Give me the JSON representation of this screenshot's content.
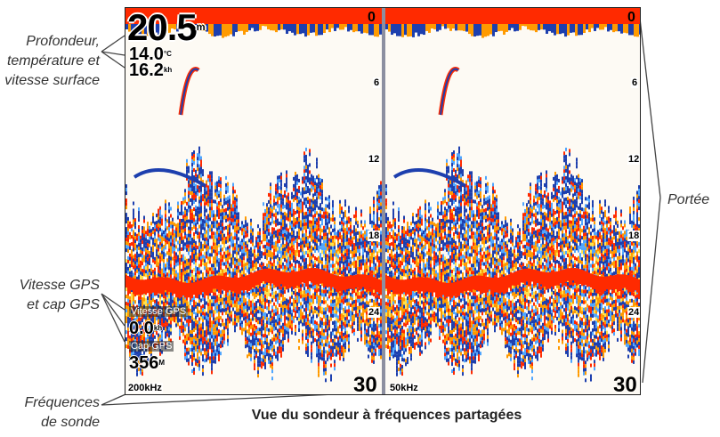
{
  "callouts": {
    "depth_temp_speed": [
      "Profondeur,",
      "température et",
      "vitesse surface"
    ],
    "gps": [
      "Vitesse GPS",
      "et cap GPS"
    ],
    "frequencies": [
      "Fréquences",
      "de sonde"
    ],
    "range": "Portée"
  },
  "caption": "Vue du sondeur à fréquences partagées",
  "left_panel": {
    "depth": "20.5",
    "depth_unit": "m",
    "temperature": "14.0",
    "temperature_unit": "°C",
    "surface_speed": "16.2",
    "surface_speed_unit": "kh",
    "gps_speed_label": "Vitesse GPS",
    "gps_speed": "0.0",
    "gps_speed_unit": "kh",
    "gps_heading_label": "Cap GPS",
    "gps_heading": "356",
    "gps_heading_unit": "M",
    "frequency": "200kHz",
    "range_bottom": "30"
  },
  "right_panel": {
    "frequency": "50kHz",
    "range_bottom": "30"
  },
  "scale_ticks": [
    "0",
    "6",
    "12",
    "18",
    "24"
  ],
  "colors": {
    "sonar_red": "#ff2a00",
    "sonar_orange": "#ff9a00",
    "sonar_yellow": "#ffe14a",
    "sonar_blue": "#1d3fae",
    "sonar_lightblue": "#4fa6ff",
    "divider": "#8c8fa0",
    "background": "#fdfaf4"
  }
}
